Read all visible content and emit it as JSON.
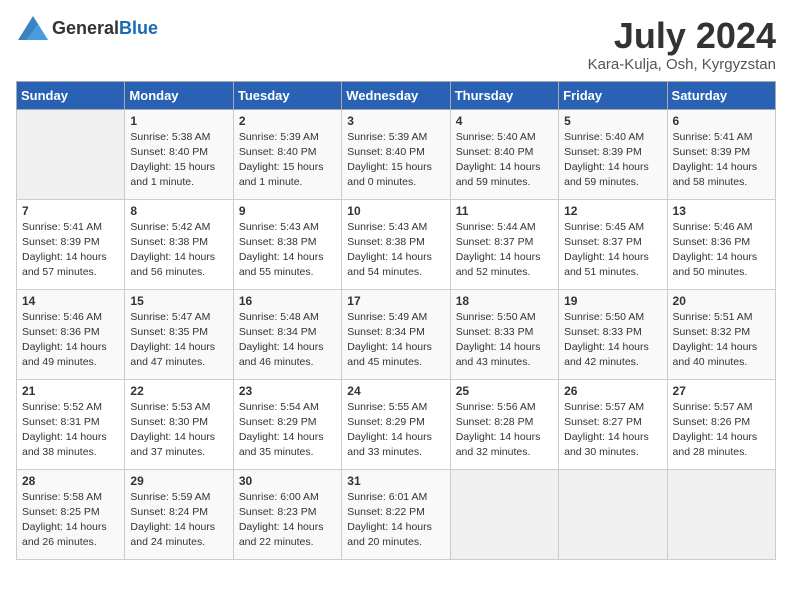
{
  "header": {
    "logo_general": "General",
    "logo_blue": "Blue",
    "month_year": "July 2024",
    "location": "Kara-Kulja, Osh, Kyrgyzstan"
  },
  "weekdays": [
    "Sunday",
    "Monday",
    "Tuesday",
    "Wednesday",
    "Thursday",
    "Friday",
    "Saturday"
  ],
  "weeks": [
    [
      {
        "day": "",
        "info": ""
      },
      {
        "day": "1",
        "info": "Sunrise: 5:38 AM\nSunset: 8:40 PM\nDaylight: 15 hours\nand 1 minute."
      },
      {
        "day": "2",
        "info": "Sunrise: 5:39 AM\nSunset: 8:40 PM\nDaylight: 15 hours\nand 1 minute."
      },
      {
        "day": "3",
        "info": "Sunrise: 5:39 AM\nSunset: 8:40 PM\nDaylight: 15 hours\nand 0 minutes."
      },
      {
        "day": "4",
        "info": "Sunrise: 5:40 AM\nSunset: 8:40 PM\nDaylight: 14 hours\nand 59 minutes."
      },
      {
        "day": "5",
        "info": "Sunrise: 5:40 AM\nSunset: 8:39 PM\nDaylight: 14 hours\nand 59 minutes."
      },
      {
        "day": "6",
        "info": "Sunrise: 5:41 AM\nSunset: 8:39 PM\nDaylight: 14 hours\nand 58 minutes."
      }
    ],
    [
      {
        "day": "7",
        "info": "Sunrise: 5:41 AM\nSunset: 8:39 PM\nDaylight: 14 hours\nand 57 minutes."
      },
      {
        "day": "8",
        "info": "Sunrise: 5:42 AM\nSunset: 8:38 PM\nDaylight: 14 hours\nand 56 minutes."
      },
      {
        "day": "9",
        "info": "Sunrise: 5:43 AM\nSunset: 8:38 PM\nDaylight: 14 hours\nand 55 minutes."
      },
      {
        "day": "10",
        "info": "Sunrise: 5:43 AM\nSunset: 8:38 PM\nDaylight: 14 hours\nand 54 minutes."
      },
      {
        "day": "11",
        "info": "Sunrise: 5:44 AM\nSunset: 8:37 PM\nDaylight: 14 hours\nand 52 minutes."
      },
      {
        "day": "12",
        "info": "Sunrise: 5:45 AM\nSunset: 8:37 PM\nDaylight: 14 hours\nand 51 minutes."
      },
      {
        "day": "13",
        "info": "Sunrise: 5:46 AM\nSunset: 8:36 PM\nDaylight: 14 hours\nand 50 minutes."
      }
    ],
    [
      {
        "day": "14",
        "info": "Sunrise: 5:46 AM\nSunset: 8:36 PM\nDaylight: 14 hours\nand 49 minutes."
      },
      {
        "day": "15",
        "info": "Sunrise: 5:47 AM\nSunset: 8:35 PM\nDaylight: 14 hours\nand 47 minutes."
      },
      {
        "day": "16",
        "info": "Sunrise: 5:48 AM\nSunset: 8:34 PM\nDaylight: 14 hours\nand 46 minutes."
      },
      {
        "day": "17",
        "info": "Sunrise: 5:49 AM\nSunset: 8:34 PM\nDaylight: 14 hours\nand 45 minutes."
      },
      {
        "day": "18",
        "info": "Sunrise: 5:50 AM\nSunset: 8:33 PM\nDaylight: 14 hours\nand 43 minutes."
      },
      {
        "day": "19",
        "info": "Sunrise: 5:50 AM\nSunset: 8:33 PM\nDaylight: 14 hours\nand 42 minutes."
      },
      {
        "day": "20",
        "info": "Sunrise: 5:51 AM\nSunset: 8:32 PM\nDaylight: 14 hours\nand 40 minutes."
      }
    ],
    [
      {
        "day": "21",
        "info": "Sunrise: 5:52 AM\nSunset: 8:31 PM\nDaylight: 14 hours\nand 38 minutes."
      },
      {
        "day": "22",
        "info": "Sunrise: 5:53 AM\nSunset: 8:30 PM\nDaylight: 14 hours\nand 37 minutes."
      },
      {
        "day": "23",
        "info": "Sunrise: 5:54 AM\nSunset: 8:29 PM\nDaylight: 14 hours\nand 35 minutes."
      },
      {
        "day": "24",
        "info": "Sunrise: 5:55 AM\nSunset: 8:29 PM\nDaylight: 14 hours\nand 33 minutes."
      },
      {
        "day": "25",
        "info": "Sunrise: 5:56 AM\nSunset: 8:28 PM\nDaylight: 14 hours\nand 32 minutes."
      },
      {
        "day": "26",
        "info": "Sunrise: 5:57 AM\nSunset: 8:27 PM\nDaylight: 14 hours\nand 30 minutes."
      },
      {
        "day": "27",
        "info": "Sunrise: 5:57 AM\nSunset: 8:26 PM\nDaylight: 14 hours\nand 28 minutes."
      }
    ],
    [
      {
        "day": "28",
        "info": "Sunrise: 5:58 AM\nSunset: 8:25 PM\nDaylight: 14 hours\nand 26 minutes."
      },
      {
        "day": "29",
        "info": "Sunrise: 5:59 AM\nSunset: 8:24 PM\nDaylight: 14 hours\nand 24 minutes."
      },
      {
        "day": "30",
        "info": "Sunrise: 6:00 AM\nSunset: 8:23 PM\nDaylight: 14 hours\nand 22 minutes."
      },
      {
        "day": "31",
        "info": "Sunrise: 6:01 AM\nSunset: 8:22 PM\nDaylight: 14 hours\nand 20 minutes."
      },
      {
        "day": "",
        "info": ""
      },
      {
        "day": "",
        "info": ""
      },
      {
        "day": "",
        "info": ""
      }
    ]
  ]
}
